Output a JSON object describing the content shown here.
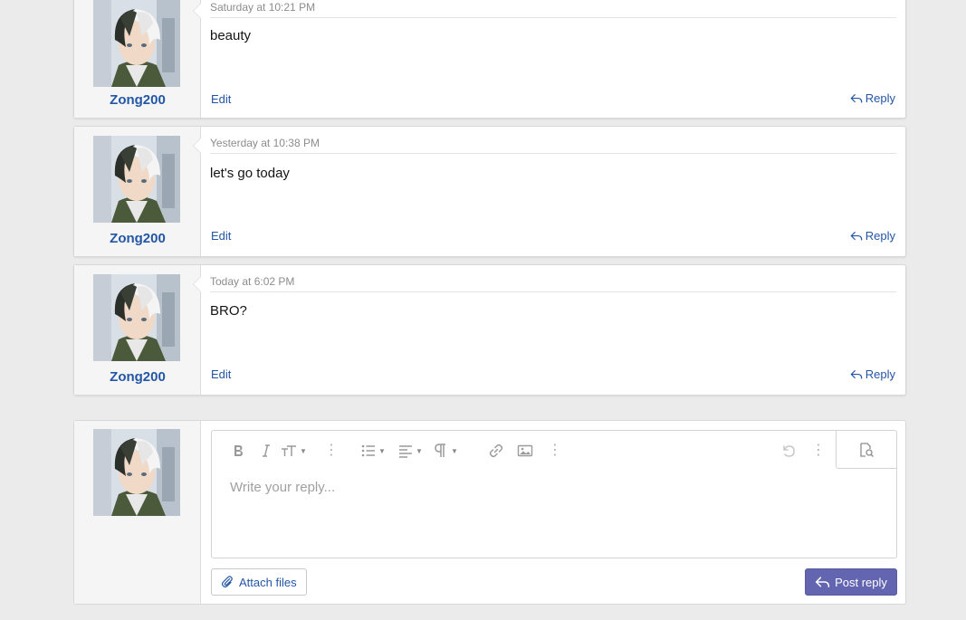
{
  "colors": {
    "accent": "#2456a6",
    "primary_button": "#6365b0",
    "background": "#ebebeb"
  },
  "posts": [
    {
      "username": "Zong200",
      "date": "Saturday at 10:21 PM",
      "text": "beauty",
      "edit": "Edit",
      "reply": "Reply"
    },
    {
      "username": "Zong200",
      "date": "Yesterday at 10:38 PM",
      "text": "let's go today",
      "edit": "Edit",
      "reply": "Reply"
    },
    {
      "username": "Zong200",
      "date": "Today at 6:02 PM",
      "text": "BRO?",
      "edit": "Edit",
      "reply": "Reply"
    }
  ],
  "editor": {
    "placeholder": "Write your reply...",
    "toolbar_icons": [
      "bold-icon",
      "italic-icon",
      "text-size-icon",
      "more-options-icon",
      "list-icon",
      "align-icon",
      "paragraph-icon",
      "more-options-icon",
      "link-icon",
      "image-icon",
      "more-options-icon",
      "undo-icon",
      "more-options-icon",
      "preview-icon"
    ],
    "attach_label": "Attach files",
    "post_label": "Post reply"
  }
}
